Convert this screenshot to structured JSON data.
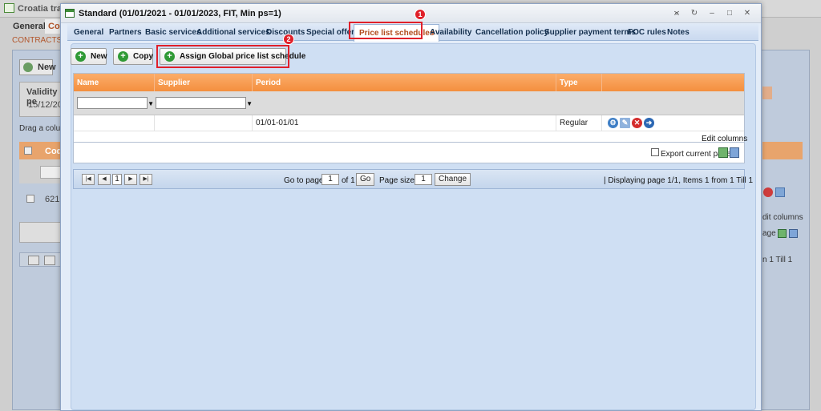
{
  "background": {
    "app_title": "Croatia tran",
    "tabs": [
      "General",
      "Co"
    ],
    "sub_label": "CONTRACTS",
    "new_label": "New",
    "validity_label": "Validity pe",
    "validity_value": "15/12/202",
    "drag_text": "Drag a colum",
    "grid_col": "Cod",
    "row_value": "6219",
    "edit_columns": "dit columns",
    "export_page": "age",
    "till_text": "n 1 Till 1"
  },
  "modal": {
    "title": "Standard (01/01/2021 - 01/01/2023, FIT, Min ps=1)",
    "window_buttons": [
      "⪤",
      "↻",
      "–",
      "□",
      "✕"
    ],
    "tabs": [
      {
        "label": "General"
      },
      {
        "label": "Partners"
      },
      {
        "label": "Basic services"
      },
      {
        "label": "Additional services"
      },
      {
        "label": "Discounts"
      },
      {
        "label": "Special offers"
      },
      {
        "label": "Price list schedules"
      },
      {
        "label": "Availability"
      },
      {
        "label": "Cancellation policy"
      },
      {
        "label": "Supplier payment terms"
      },
      {
        "label": "FOC rules"
      },
      {
        "label": "Notes"
      }
    ],
    "active_tab": "Price list schedules",
    "toolbar": {
      "new_label": "New",
      "copy_label": "Copy",
      "assign_label": "Assign Global price list schedule"
    },
    "grid": {
      "columns": [
        "Name",
        "Supplier",
        "Period",
        "Type"
      ],
      "rows": [
        {
          "name": "",
          "supplier": "",
          "period": "01/01-01/01",
          "type": "Regular"
        }
      ],
      "edit_columns": "Edit columns",
      "export_label": "Export current page"
    },
    "pager": {
      "go_to_page_label": "Go to page:",
      "page_value": "1",
      "of_label": "of 1",
      "go_label": "Go",
      "page_size_label": "Page size:",
      "page_size_value": "1",
      "change_label": "Change",
      "current_page": "1",
      "display_text": "| Displaying page  1/1,  Items  1  from  1  Till  1"
    },
    "callouts": [
      "1",
      "2"
    ]
  },
  "colors": {
    "grid_header": "#f48f3e",
    "active_tab_text": "#b24a1b",
    "callout": "#e0202a",
    "add_icon": "#2f9a35"
  }
}
